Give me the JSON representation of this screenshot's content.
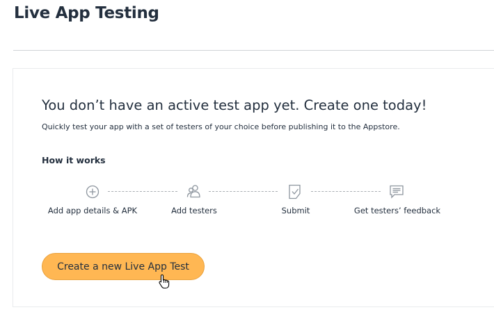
{
  "page": {
    "title": "Live App Testing"
  },
  "empty_state": {
    "headline": "You don’t have an active test app yet. Create one today!",
    "description": "Quickly test your app with a set of testers of your choice before publishing it to the Appstore.",
    "how_it_works_heading": "How it works",
    "steps": [
      {
        "icon": "plus-circle-icon",
        "label": "Add app details & APK"
      },
      {
        "icon": "people-icon",
        "label": "Add testers"
      },
      {
        "icon": "checked-document-icon",
        "label": "Submit"
      },
      {
        "icon": "chat-bubble-icon",
        "label": "Get testers’ feedback"
      }
    ],
    "cta_label": "Create a new Live App Test"
  },
  "colors": {
    "accent": "#ffb753",
    "text": "#232f3e",
    "icon": "#8d959e"
  }
}
